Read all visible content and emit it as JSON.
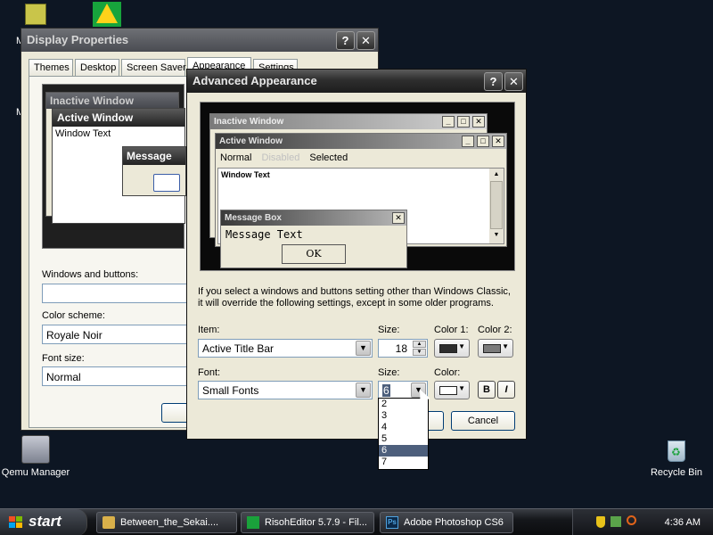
{
  "desktop": {
    "icons": [
      {
        "label": "Qemu Manager"
      },
      {
        "label": "Recycle Bin"
      }
    ],
    "partial_labels": [
      "M",
      "M"
    ]
  },
  "display_properties": {
    "title": "Display Properties",
    "tabs": [
      "Themes",
      "Desktop",
      "Screen Saver",
      "Appearance",
      "Settings"
    ],
    "preview": {
      "inactive_title": "Inactive Window",
      "active_title": "Active Window",
      "window_text": "Window Text",
      "message_title": "Message"
    },
    "windows_buttons_label": "Windows and buttons:",
    "windows_buttons_value": "",
    "color_scheme_label": "Color scheme:",
    "color_scheme_value": "Royale Noir",
    "font_size_label": "Font size:",
    "font_size_value": "Normal"
  },
  "advanced": {
    "title": "Advanced Appearance",
    "preview": {
      "inactive_title": "Inactive Window",
      "active_title": "Active Window",
      "menu_normal": "Normal",
      "menu_disabled": "Disabled",
      "menu_selected": "Selected",
      "window_text": "Window Text",
      "msgbox_title": "Message Box",
      "msgbox_text": "Message Text",
      "ok_label": "OK"
    },
    "info_text_line1": "If you select a windows and buttons setting other than Windows Classic,",
    "info_text_line2": "it will override the following settings, except in some older programs.",
    "item_label": "Item:",
    "item_value": "Active Title Bar",
    "size_label": "Size:",
    "size_value": "18",
    "color1_label": "Color 1:",
    "color2_label": "Color 2:",
    "font_label": "Font:",
    "font_value": "Small Fonts",
    "font_size_label": "Size:",
    "font_size_value": "6",
    "font_color_label": "Color:",
    "bold_label": "B",
    "italic_label": "I",
    "ok_button": "OK",
    "cancel_button": "Cancel",
    "size_options": [
      "2",
      "3",
      "4",
      "5",
      "6",
      "7"
    ],
    "selected_option": "6",
    "colors": {
      "color1": "#2d2d2d",
      "color2": "#7a7a7a",
      "font_color": "#ffffff"
    }
  },
  "taskbar": {
    "start_label": "start",
    "buttons": [
      {
        "label": "Between_the_Sekai....",
        "icon": "folder-icon"
      },
      {
        "label": "RisohEditor 5.7.9 - Fil...",
        "icon": "risoheditor-icon"
      },
      {
        "label": "Adobe Photoshop CS6",
        "icon": "photoshop-icon"
      }
    ],
    "clock": "4:36 AM"
  }
}
